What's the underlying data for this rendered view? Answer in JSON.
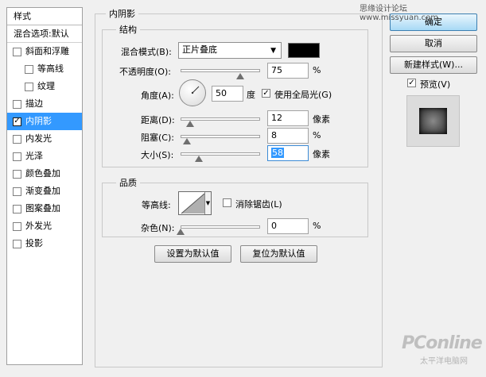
{
  "watermark_top": "思缘设计论坛 www.missyuan.com",
  "sidebar": {
    "header": "样式",
    "blend_options": "混合选项:默认",
    "items": [
      {
        "label": "斜面和浮雕",
        "checked": false,
        "indent": false
      },
      {
        "label": "等高线",
        "checked": false,
        "indent": true
      },
      {
        "label": "纹理",
        "checked": false,
        "indent": true
      },
      {
        "label": "描边",
        "checked": false,
        "indent": false
      },
      {
        "label": "内阴影",
        "checked": true,
        "indent": false,
        "selected": true
      },
      {
        "label": "内发光",
        "checked": false,
        "indent": false
      },
      {
        "label": "光泽",
        "checked": false,
        "indent": false
      },
      {
        "label": "颜色叠加",
        "checked": false,
        "indent": false
      },
      {
        "label": "渐变叠加",
        "checked": false,
        "indent": false
      },
      {
        "label": "图案叠加",
        "checked": false,
        "indent": false
      },
      {
        "label": "外发光",
        "checked": false,
        "indent": false
      },
      {
        "label": "投影",
        "checked": false,
        "indent": false
      }
    ]
  },
  "panel": {
    "title": "内阴影",
    "structure": {
      "title": "结构",
      "blend_mode_label": "混合模式(B):",
      "blend_mode_value": "正片叠底",
      "blend_color": "#000000",
      "opacity_label": "不透明度(O):",
      "opacity_value": "75",
      "opacity_level": 0.75,
      "angle_label": "角度(A):",
      "angle_value": "50",
      "angle_unit": "度",
      "global_light_label": "使用全局光(G)",
      "global_light_checked": true,
      "distance_label": "距离(D):",
      "distance_value": "12",
      "distance_level": 0.12,
      "choke_label": "阻塞(C):",
      "choke_value": "8",
      "choke_level": 0.08,
      "size_label": "大小(S):",
      "size_value": "58",
      "size_level": 0.23,
      "unit_pct": "%",
      "unit_px": "像素"
    },
    "quality": {
      "title": "品质",
      "contour_label": "等高线:",
      "antialias_label": "消除锯齿(L)",
      "antialias_checked": false,
      "noise_label": "杂色(N):",
      "noise_value": "0",
      "noise_level": 0.0,
      "unit_pct": "%"
    },
    "make_default": "设置为默认值",
    "reset_default": "复位为默认值"
  },
  "buttons": {
    "ok": "确定",
    "cancel": "取消",
    "new_style": "新建样式(W)...",
    "preview_label": "预览(V)",
    "preview_checked": true
  },
  "watermark_bottom": {
    "brand": "PConline",
    "sub": "太平洋电脑网"
  }
}
